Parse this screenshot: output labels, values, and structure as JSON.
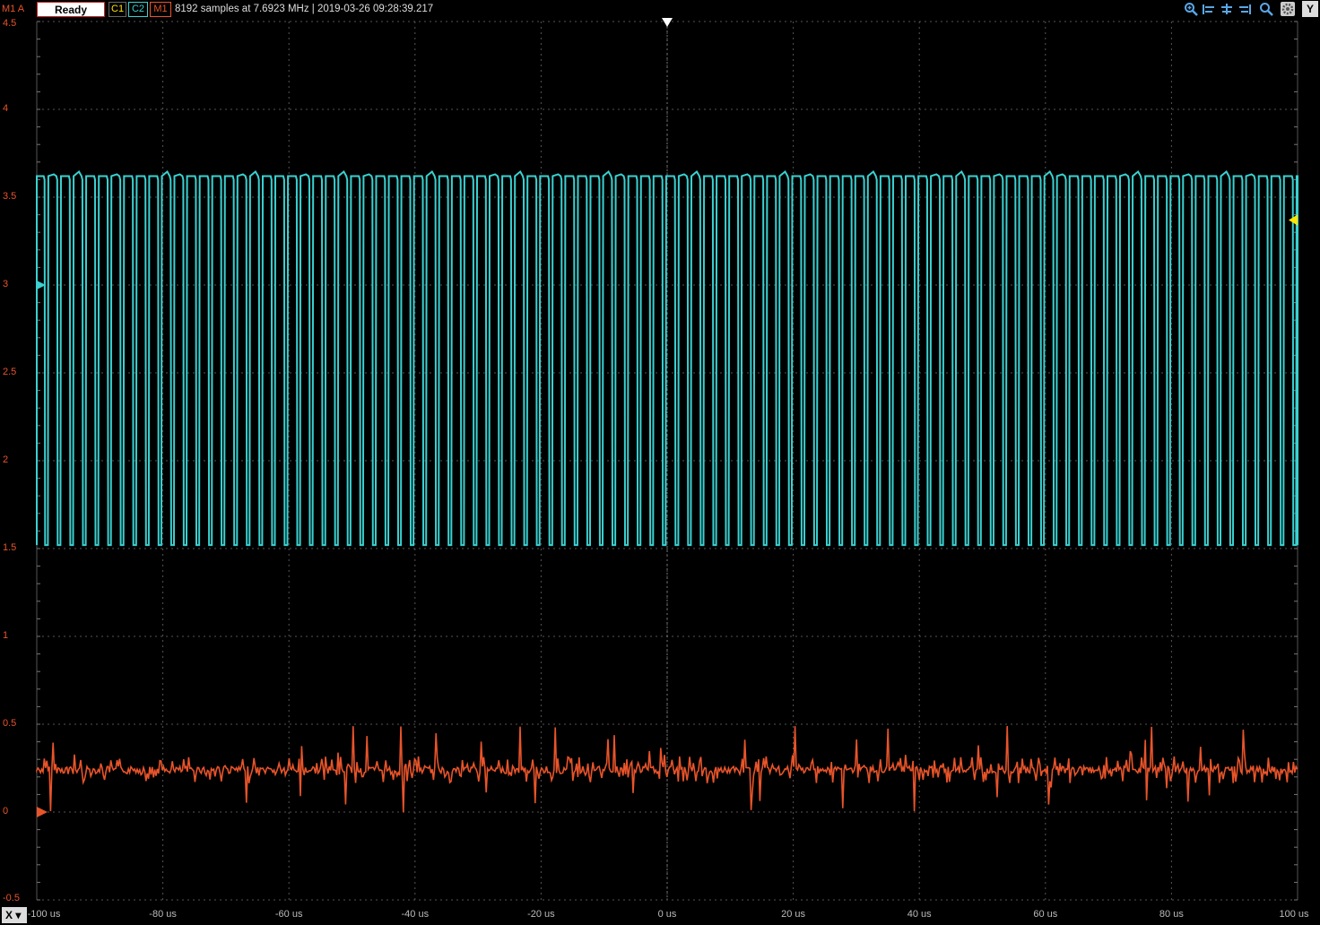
{
  "header": {
    "channel_indicator": "M1 A",
    "status": "Ready",
    "channels": [
      "C1",
      "C2",
      "M1"
    ],
    "info": "8192 samples at 7.6923 MHz | 2019-03-26 09:28:39.217",
    "y_button": "Y",
    "x_button": "X",
    "tools": [
      "zoom-in-icon",
      "align-left-icon",
      "align-center-icon",
      "align-right-icon",
      "zoom-icon",
      "settings-icon"
    ]
  },
  "colors": {
    "c1": "#ffe400",
    "c2": "#3ad1d1",
    "m1": "#e8542a",
    "grid": "#555555",
    "background": "#000000"
  },
  "chart_data": {
    "type": "line",
    "xlabel": "",
    "ylabel": "",
    "xlim": [
      -100,
      100
    ],
    "ylim": [
      -0.5,
      4.5
    ],
    "x_ticks": [
      "-100 us",
      "-80 us",
      "-60 us",
      "-40 us",
      "-20 us",
      "0 us",
      "20 us",
      "40 us",
      "60 us",
      "80 us",
      "100 us"
    ],
    "y_ticks": [
      "4.5",
      "4",
      "3.5",
      "3",
      "2.5",
      "2",
      "1.5",
      "1",
      "0.5",
      "0",
      "-0.5"
    ],
    "grid": true,
    "series": [
      {
        "name": "C2",
        "color": "#3ad1d1",
        "shape": "square pulse train",
        "high": 3.62,
        "low": 1.52,
        "pulse_count": 100,
        "offset_marker": 3.0
      },
      {
        "name": "M1",
        "color": "#e8542a",
        "shape": "noisy current spikes",
        "baseline": 0.24,
        "spike_max": 0.47,
        "spike_min": -0.03,
        "offset_marker": 0.0
      }
    ],
    "trigger_time": 0,
    "trigger_level_marker": 3.37
  }
}
